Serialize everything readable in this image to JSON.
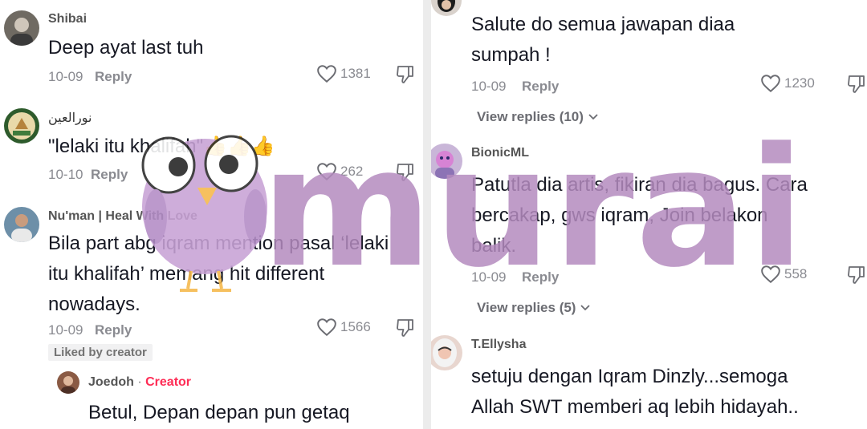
{
  "left_comments": [
    {
      "user": "Shibai",
      "text": "Deep ayat last tuh",
      "date": "10-09",
      "reply": "Reply",
      "likes": "1381"
    },
    {
      "user": "نورالعين",
      "text": "\"lelaki itu khalifah\"👍👍👍",
      "date": "10-10",
      "reply": "Reply",
      "likes": "262"
    },
    {
      "user": "Nu'man | Heal With Love",
      "text_lines": [
        "Bila part abg iqram mention pasal ‘lelaki",
        "itu khalifah’ memang hit different",
        "nowadays."
      ],
      "date": "10-09",
      "reply": "Reply",
      "likes": "1566",
      "badge": "Liked by creator"
    }
  ],
  "left_reply": {
    "user": "Joedoh",
    "separator": "·",
    "role": "Creator",
    "text": "Betul, Depan depan pun getaq"
  },
  "right_comments": [
    {
      "text_lines": [
        "Salute do semua jawapan diaa",
        "sumpah !"
      ],
      "date": "10-09",
      "reply": "Reply",
      "likes": "1230",
      "view_replies": "View replies (10)"
    },
    {
      "user": "BionicML",
      "text_lines": [
        "Patutla dia artis, fikiran dia bagus. Cara",
        "bercakap, gws iqram, Join belakon",
        "balik."
      ],
      "date": "10-09",
      "reply": "Reply",
      "likes": "558",
      "view_replies": "View replies (5)"
    },
    {
      "user": "T.Ellysha",
      "text_lines": [
        "setuju dengan Iqram Dinzly...semoga",
        "Allah SWT memberi aq lebih hidayah.."
      ]
    }
  ],
  "watermark": {
    "text": "murai",
    "color": "#b48bbf"
  },
  "colors": {
    "text": "#161823",
    "meta": "#8a8b91",
    "creator": "#fe2c55"
  }
}
